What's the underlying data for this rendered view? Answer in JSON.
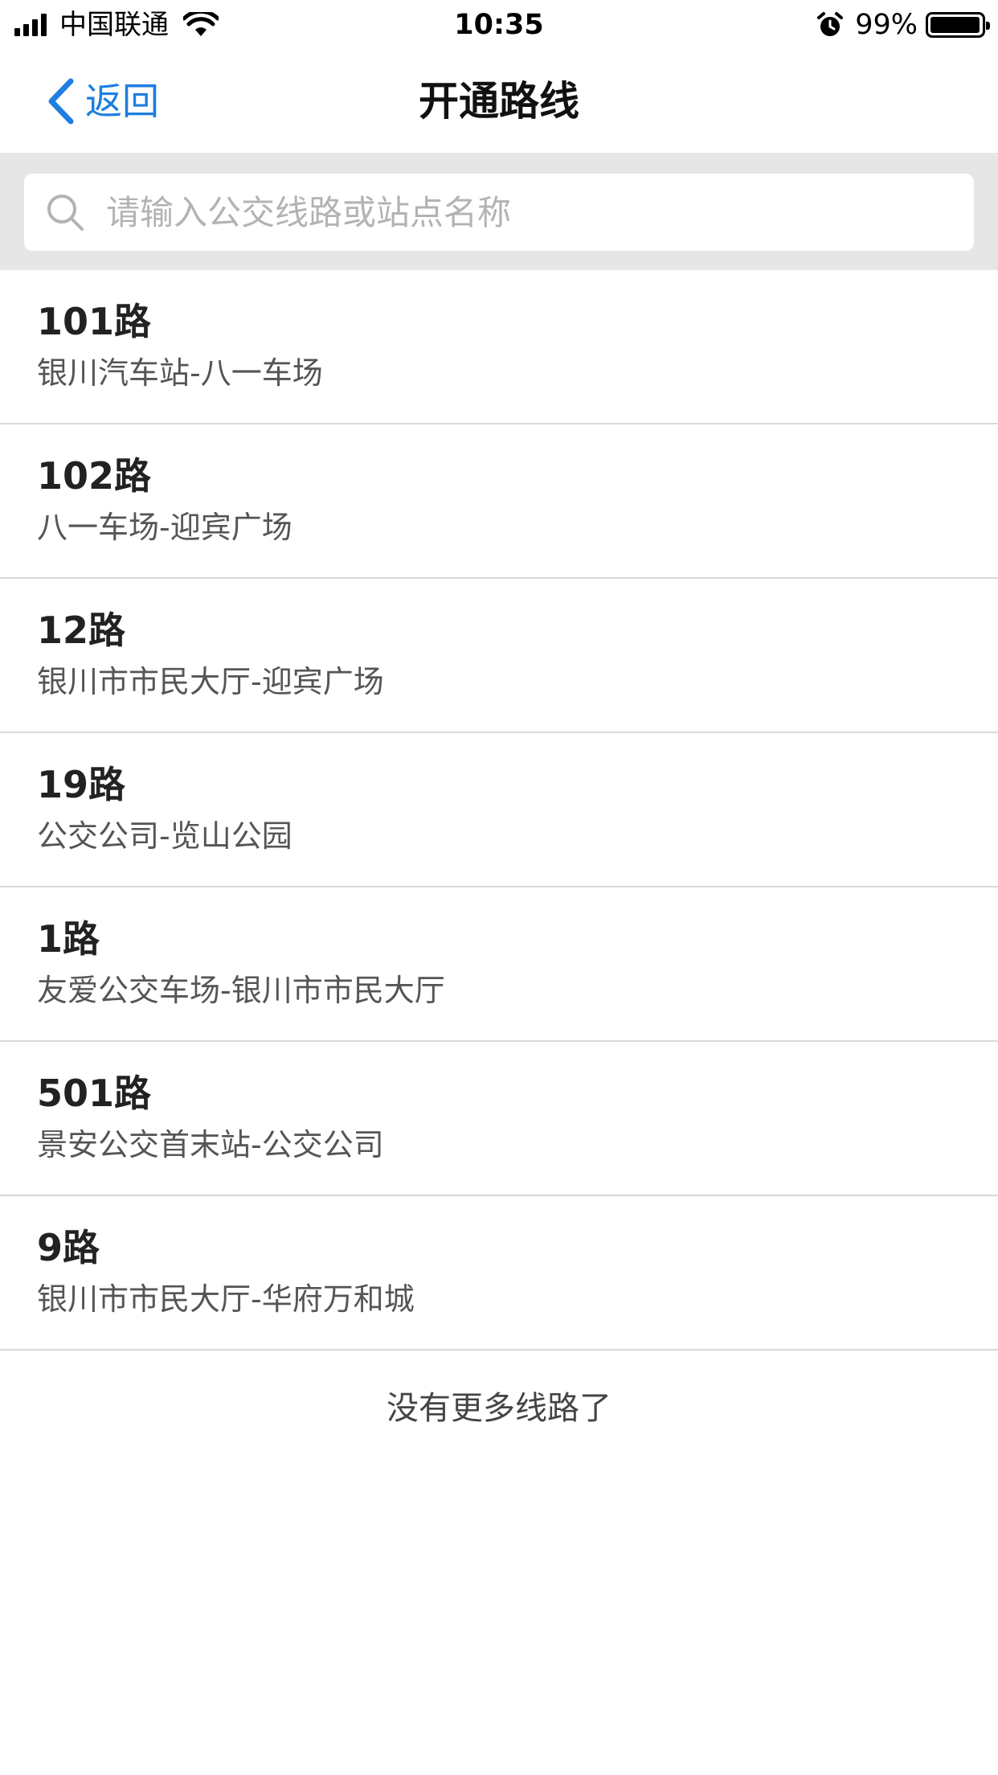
{
  "status_bar": {
    "carrier": "中国联通",
    "time": "10:35",
    "battery": "99%",
    "battery_level": 0.99,
    "icons": [
      "signal-icon",
      "wifi-icon",
      "alarm-icon",
      "battery-icon"
    ]
  },
  "nav": {
    "back_label": "返回",
    "title": "开通路线"
  },
  "search": {
    "placeholder": "请输入公交线路或站点名称",
    "value": ""
  },
  "routes": [
    {
      "name": "101路",
      "stops": "银川汽车站-八一车场"
    },
    {
      "name": "102路",
      "stops": "八一车场-迎宾广场"
    },
    {
      "name": "12路",
      "stops": "银川市市民大厅-迎宾广场"
    },
    {
      "name": "19路",
      "stops": "公交公司-览山公园"
    },
    {
      "name": "1路",
      "stops": "友爱公交车场-银川市市民大厅"
    },
    {
      "name": "501路",
      "stops": "景安公交首末站-公交公司"
    },
    {
      "name": "9路",
      "stops": "银川市市民大厅-华府万和城"
    }
  ],
  "footer": {
    "no_more": "没有更多线路了"
  },
  "colors": {
    "accent": "#1f7ee0",
    "search_bg": "#e6e6e6",
    "divider": "#d9d9d9"
  }
}
